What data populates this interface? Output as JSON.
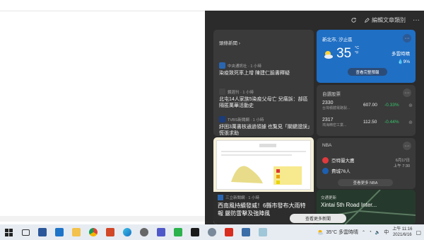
{
  "header": {
    "edit_label": "編輯文章類別"
  },
  "news": {
    "heading": "頭條新聞",
    "items": [
      {
        "source": "中央通訊社 · 1 小時",
        "title": "染疫致死率上增 陳建仁臉書釋疑"
      },
      {
        "source": "鏡週刊 · 1 小時",
        "title": "北屯14人家族5染疫父母亡 兒痛訴：部區隔匿萬華活動史"
      },
      {
        "source": "TVBS新聞網 · 1 小時",
        "title": "紓困3萬書核通過領據 也覧見「關鍵證誤」慌張求助"
      }
    ]
  },
  "featured": {
    "source": "三立新聞網 · 1 小時",
    "title": "西南風持續發威！6縣市發布大雨特報 嚴防雷擊及強陣風",
    "more": "查看更多新聞"
  },
  "weather": {
    "location": "新北市, 汐止區",
    "temp": "35",
    "unit_c": "°C",
    "unit_f": "°F",
    "condition": "多雲時晴",
    "rain": "9%",
    "forecast": "查看完整預報"
  },
  "stocks": {
    "heading": "自選股票",
    "rows": [
      {
        "symbol": "2330",
        "name": "台灣積體電路製...",
        "price": "607.00",
        "change": "-0.33%"
      },
      {
        "symbol": "2317",
        "name": "鴻海精密工業...",
        "price": "112.50",
        "change": "-0.44%"
      }
    ]
  },
  "nba": {
    "heading": "NBA",
    "team1": "亞特蘭大鷹",
    "team2": "費城76人",
    "date": "6月17日",
    "time": "上午 7:30",
    "more": "查看更多 NBA"
  },
  "traffic": {
    "heading": "交通更新",
    "title": "Xintai 5th Road Inter..."
  },
  "taskbar": {
    "weather": "35°C  多雲時晴",
    "ime": "中",
    "time": "上午 11:16",
    "date": "2021/6/16"
  },
  "colors": {
    "weather_bg": "#1f6fc4",
    "up": "#36c36b",
    "panel": "#2b2b2b"
  }
}
